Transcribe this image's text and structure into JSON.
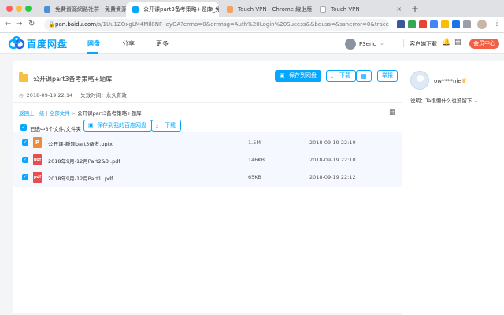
{
  "browser": {
    "tabs": [
      {
        "title": "免費資源網路社群 - 免費資源指",
        "color": "#4a90d9"
      },
      {
        "title": "公开课part3备考策略+题库_免费",
        "color": "#06a7ff"
      },
      {
        "title": "Touch VPN - Chrome 線上應用",
        "color": "#f4a261"
      },
      {
        "title": "Touch VPN",
        "color": "#cccccc"
      }
    ],
    "url_host": "pan.baidu.com",
    "url_path": "/s/1Uu1ZQxgLM4MIl8NF-leyGA?errno=0&errmsg=Auth%20Login%20Sucess&&bduss=&ssnerror=0&traceid=#list..."
  },
  "header": {
    "logo_text": "百度网盘",
    "nav": [
      "网盘",
      "分享",
      "更多"
    ],
    "username": "P3eric",
    "client_download": "客户端下载",
    "vip_button": "会员中心"
  },
  "share": {
    "title": "公开课part3备考策略+题库",
    "created": "2018-09-19 22:14",
    "expire_label": "失效时间：永久有效",
    "save_button": "保存到网盘",
    "download_button": "下载",
    "report_button": "举报"
  },
  "breadcrumb": {
    "back": "返回上一级",
    "all": "全部文件",
    "current": "公开课part3备考策略+题库"
  },
  "selection": {
    "text": "已选中3个文件/文件夹",
    "save_button": "保存到我的百度网盘",
    "download_button": "下载"
  },
  "files": [
    {
      "name": "公开课-新题part3备考.pptx",
      "size": "1.5M",
      "date": "2018-09-19 22:10",
      "type": "P",
      "color": "#f08a3b"
    },
    {
      "name": "2018年9月-12月Part2&3 .pdf",
      "size": "146KB",
      "date": "2018-09-19 22:10",
      "type": "pdf",
      "color": "#e94e4e"
    },
    {
      "name": "2018年9月-12月Part1 .pdf",
      "size": "65KB",
      "date": "2018-09-19 22:12",
      "type": "pdf",
      "color": "#e94e4e"
    }
  ],
  "sidebar": {
    "owner": "ow****nie",
    "description": "说明：Ta很懒什么也没留下"
  }
}
